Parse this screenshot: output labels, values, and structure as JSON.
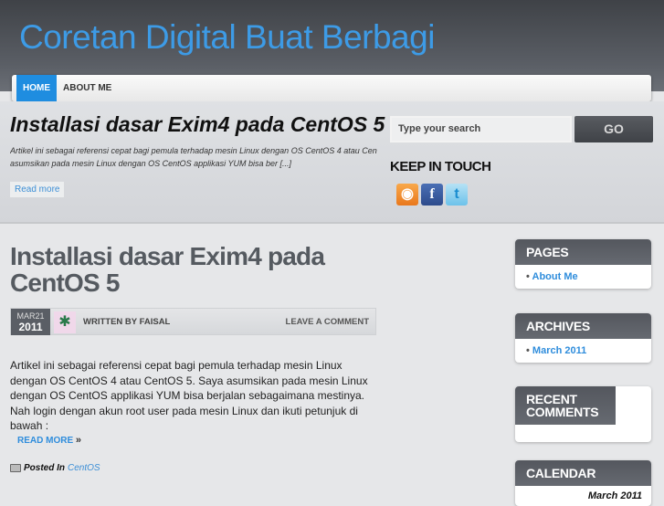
{
  "site": {
    "title": "Coretan Digital Buat Berbagi"
  },
  "nav": {
    "items": [
      {
        "label": "HOME",
        "active": true
      },
      {
        "label": "ABOUT ME"
      }
    ]
  },
  "featured": {
    "title": "Installasi dasar Exim4 pada CentOS 5",
    "excerpt_line1": "Artikel ini sebagai referensi cepat bagi pemula terhadap mesin Linux dengan OS CentOS 4 atau Cen",
    "excerpt_line2": "asumsikan pada mesin Linux dengan OS CentOS applikasi YUM bisa ber [...]",
    "read_more": "Read more"
  },
  "search": {
    "placeholder": "Type your search",
    "button": "GO"
  },
  "keep_in_touch": {
    "title": "KEEP IN TOUCH",
    "icons": [
      "rss-icon",
      "facebook-icon",
      "twitter-icon"
    ]
  },
  "post": {
    "title": "Installasi dasar Exim4 pada CentOS 5",
    "date_month": "MAR21",
    "date_year": "2011",
    "written_by": "WRITTEN BY FAISAL",
    "leave_comment": "LEAVE A COMMENT",
    "body": "Artikel ini sebagai referensi cepat bagi pemula terhadap mesin Linux dengan OS CentOS 4 atau CentOS 5. Saya asumsikan pada mesin Linux dengan OS CentOS applikasi YUM bisa berjalan sebagaimana mestinya. Nah login dengan akun root user pada mesin Linux dan ikuti petunjuk di bawah :",
    "read_more": "READ MORE",
    "read_more_arrow": "»",
    "posted_in": "Posted In",
    "category": "CentOS"
  },
  "sidebar": {
    "pages": {
      "title": "PAGES",
      "item": "About Me"
    },
    "archives": {
      "title": "ARCHIVES",
      "item": "March 2011"
    },
    "recent_comments": {
      "title": "RECENT COMMENTS"
    },
    "calendar": {
      "title": "CALENDAR",
      "caption": "March 2011"
    }
  },
  "colors": {
    "accent": "#1f8de0",
    "title": "#3d9be6",
    "header": "#4a4e55"
  }
}
